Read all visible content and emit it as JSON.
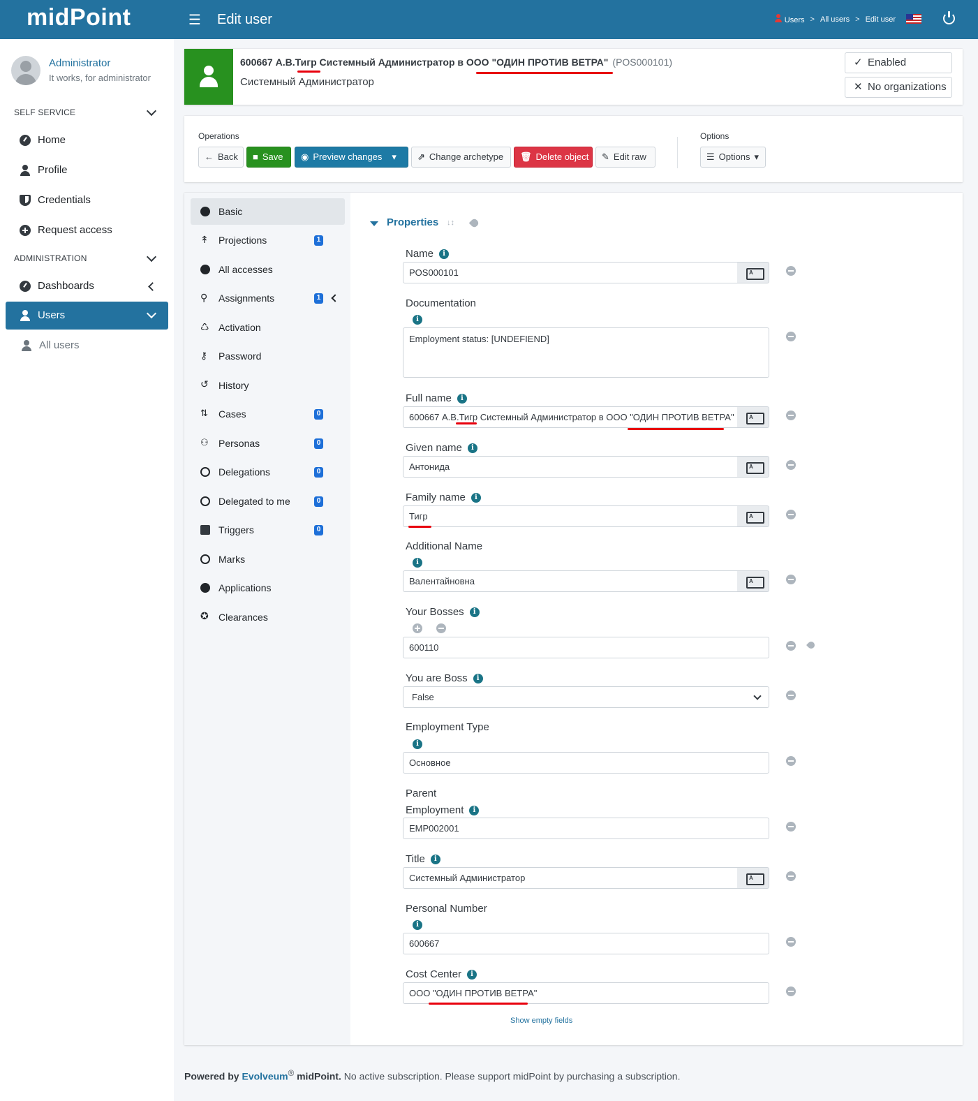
{
  "header": {
    "logo": "midPoint",
    "page_title": "Edit user",
    "breadcrumbs": [
      "Users",
      "All users",
      "Edit user"
    ],
    "breadcrumb_sep": ">"
  },
  "sidebar": {
    "user_name": "Administrator",
    "user_subtitle": "It works, for administrator",
    "sections": [
      {
        "title": "SELF SERVICE",
        "items": [
          "Home",
          "Profile",
          "Credentials",
          "Request access"
        ]
      },
      {
        "title": "ADMINISTRATION",
        "items": [
          "Dashboards",
          "Users"
        ]
      }
    ],
    "sub_item": "All users"
  },
  "object": {
    "title_prefix": "600667 А.В.",
    "title_name": "Тигр",
    "title_mid": " Системный Администратор в ",
    "title_org": "ООО \"ОДИН ПРОТИВ ВЕТРА\"",
    "oid": "(POS000101)",
    "subtitle": "Системный Администратор",
    "status": [
      "Enabled",
      "No organizations"
    ],
    "status_marks": [
      "✓",
      "✕"
    ]
  },
  "operations": {
    "label": "Operations",
    "buttons": [
      "Back",
      "Save",
      "Preview changes",
      "Change archetype",
      "Delete object",
      "Edit raw"
    ],
    "options_label": "Options",
    "options_button": "Options"
  },
  "tabs": [
    {
      "label": "Basic"
    },
    {
      "label": "Projections",
      "badge": "1"
    },
    {
      "label": "All accesses"
    },
    {
      "label": "Assignments",
      "badge": "1"
    },
    {
      "label": "Activation"
    },
    {
      "label": "Password"
    },
    {
      "label": "History"
    },
    {
      "label": "Cases",
      "badge": "0"
    },
    {
      "label": "Personas",
      "badge": "0"
    },
    {
      "label": "Delegations",
      "badge": "0"
    },
    {
      "label": "Delegated to me",
      "badge": "0"
    },
    {
      "label": "Triggers",
      "badge": "0"
    },
    {
      "label": "Marks"
    },
    {
      "label": "Applications"
    },
    {
      "label": "Clearances"
    }
  ],
  "properties": {
    "title": "Properties",
    "show_empty": "Show empty fields",
    "fields": {
      "name": {
        "label": "Name",
        "value": "POS000101"
      },
      "documentation": {
        "label": "Documentation",
        "value": "Employment status: [UNDEFIEND]"
      },
      "full_name": {
        "label": "Full name",
        "value_prefix": "600667 А.В.",
        "value_name": "Тигр",
        "value_mid": " Системный Администратор в ООО ",
        "value_org": "\"ОДИН ПРОТИВ ВЕТРА\""
      },
      "given_name": {
        "label": "Given name",
        "value": "Антонида"
      },
      "family_name": {
        "label": "Family name",
        "value": "Тигр"
      },
      "additional_name": {
        "label": "Additional Name",
        "value": "Валентайновна"
      },
      "your_bosses": {
        "label": "Your Bosses",
        "value": "600110"
      },
      "you_are_boss": {
        "label": "You are Boss",
        "value": "False"
      },
      "employment_type": {
        "label": "Employment Type",
        "value": "Основное"
      },
      "parent_employment": {
        "label_line1": "Parent",
        "label_line2": "Employment",
        "value": "EMP002001"
      },
      "title": {
        "label": "Title",
        "value": "Системный Администратор"
      },
      "personal_number": {
        "label": "Personal Number",
        "value": "600667"
      },
      "cost_center": {
        "label": "Cost Center",
        "value": "ООО \"ОДИН ПРОТИВ ВЕТРА\""
      }
    }
  },
  "footer": {
    "powered": "Powered by",
    "brand": "Evolveum",
    "reg": "®",
    "product": "midPoint.",
    "message": "No active subscription. Please support midPoint by purchasing a subscription."
  },
  "icons": {
    "info": "i",
    "sort": "↓↕",
    "hamburger": "☰",
    "back": "←",
    "save": "■",
    "preview": "◉",
    "archetype": "⇗",
    "delete": "🗑",
    "edit": "✎",
    "options": "☰",
    "dropdown": "▾"
  }
}
